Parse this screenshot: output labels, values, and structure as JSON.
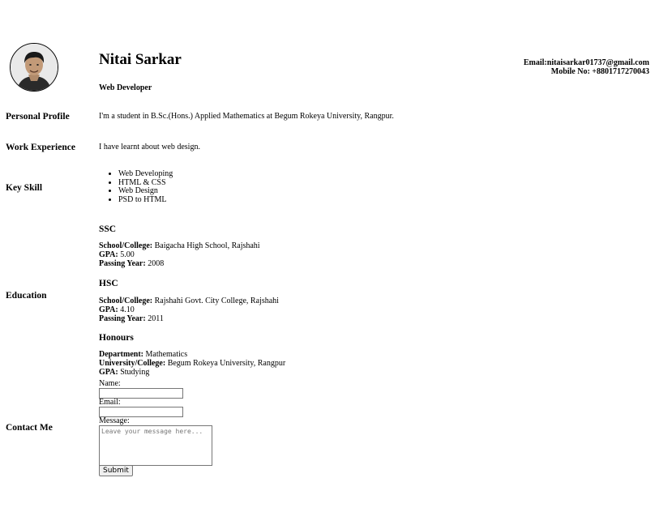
{
  "header": {
    "name": "Nitai Sarkar",
    "role": "Web Developer",
    "email": "Email:nitaisarkar01737@gmail.com",
    "mobile": "Mobile No: +8801717270043"
  },
  "profile": {
    "label": "Personal Profile",
    "text": "I'm a student in B.Sc.(Hons.) Applied Mathematics at Begum Rokeya University, Rangpur."
  },
  "experience": {
    "label": "Work Experience",
    "text": "I have learnt about web design."
  },
  "skills": {
    "label": "Key Skill",
    "items": [
      "Web Developing",
      "HTML & CSS",
      "Web Design",
      "PSD to HTML"
    ]
  },
  "education": {
    "label": "Education",
    "ssc": {
      "title": "SSC",
      "school_label": "School/College:",
      "school": "Baigacha High School, Rajshahi",
      "gpa_label": "GPA:",
      "gpa": "5.00",
      "year_label": "Passing Year:",
      "year": "2008"
    },
    "hsc": {
      "title": "HSC",
      "school_label": "School/College:",
      "school": "Rajshahi Govt. City College, Rajshahi",
      "gpa_label": "GPA:",
      "gpa": "4.10",
      "year_label": "Passing Year:",
      "year": "2011"
    },
    "honours": {
      "title": "Honours",
      "dept_label": "Department:",
      "dept": "Mathematics",
      "uni_label": "University/College:",
      "uni": "Begum Rokeya University, Rangpur",
      "gpa_label": "GPA:",
      "gpa": "Studying"
    }
  },
  "contact": {
    "label": "Contact Me",
    "name_label": "Name:",
    "name_value": "",
    "email_label": "Email:",
    "email_value": "",
    "message_label": "Message:",
    "message_placeholder": "Leave your message here...",
    "submit_label": "Submit"
  },
  "icons": {
    "avatar": "profile-photo"
  }
}
